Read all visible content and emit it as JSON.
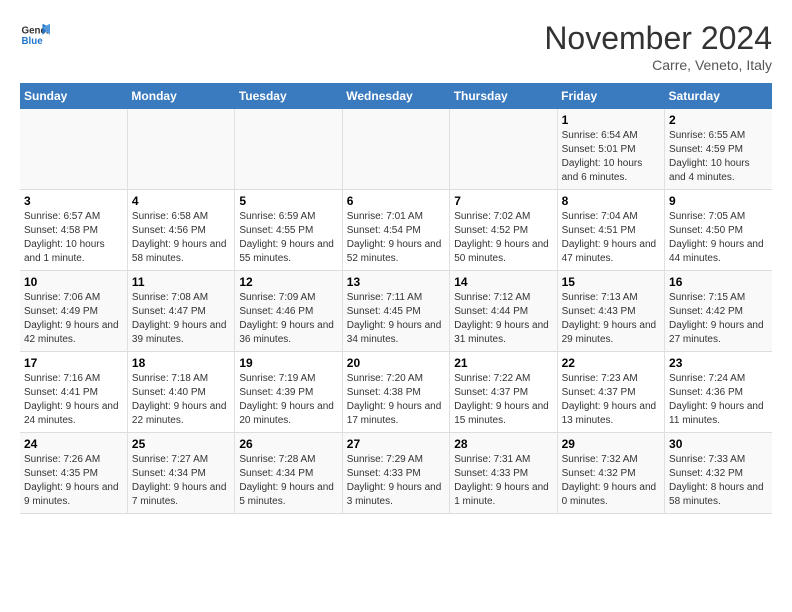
{
  "logo": {
    "general": "General",
    "blue": "Blue"
  },
  "title": "November 2024",
  "subtitle": "Carre, Veneto, Italy",
  "days_header": [
    "Sunday",
    "Monday",
    "Tuesday",
    "Wednesday",
    "Thursday",
    "Friday",
    "Saturday"
  ],
  "weeks": [
    [
      {
        "day": "",
        "info": ""
      },
      {
        "day": "",
        "info": ""
      },
      {
        "day": "",
        "info": ""
      },
      {
        "day": "",
        "info": ""
      },
      {
        "day": "",
        "info": ""
      },
      {
        "day": "1",
        "info": "Sunrise: 6:54 AM\nSunset: 5:01 PM\nDaylight: 10 hours and 6 minutes."
      },
      {
        "day": "2",
        "info": "Sunrise: 6:55 AM\nSunset: 4:59 PM\nDaylight: 10 hours and 4 minutes."
      }
    ],
    [
      {
        "day": "3",
        "info": "Sunrise: 6:57 AM\nSunset: 4:58 PM\nDaylight: 10 hours and 1 minute."
      },
      {
        "day": "4",
        "info": "Sunrise: 6:58 AM\nSunset: 4:56 PM\nDaylight: 9 hours and 58 minutes."
      },
      {
        "day": "5",
        "info": "Sunrise: 6:59 AM\nSunset: 4:55 PM\nDaylight: 9 hours and 55 minutes."
      },
      {
        "day": "6",
        "info": "Sunrise: 7:01 AM\nSunset: 4:54 PM\nDaylight: 9 hours and 52 minutes."
      },
      {
        "day": "7",
        "info": "Sunrise: 7:02 AM\nSunset: 4:52 PM\nDaylight: 9 hours and 50 minutes."
      },
      {
        "day": "8",
        "info": "Sunrise: 7:04 AM\nSunset: 4:51 PM\nDaylight: 9 hours and 47 minutes."
      },
      {
        "day": "9",
        "info": "Sunrise: 7:05 AM\nSunset: 4:50 PM\nDaylight: 9 hours and 44 minutes."
      }
    ],
    [
      {
        "day": "10",
        "info": "Sunrise: 7:06 AM\nSunset: 4:49 PM\nDaylight: 9 hours and 42 minutes."
      },
      {
        "day": "11",
        "info": "Sunrise: 7:08 AM\nSunset: 4:47 PM\nDaylight: 9 hours and 39 minutes."
      },
      {
        "day": "12",
        "info": "Sunrise: 7:09 AM\nSunset: 4:46 PM\nDaylight: 9 hours and 36 minutes."
      },
      {
        "day": "13",
        "info": "Sunrise: 7:11 AM\nSunset: 4:45 PM\nDaylight: 9 hours and 34 minutes."
      },
      {
        "day": "14",
        "info": "Sunrise: 7:12 AM\nSunset: 4:44 PM\nDaylight: 9 hours and 31 minutes."
      },
      {
        "day": "15",
        "info": "Sunrise: 7:13 AM\nSunset: 4:43 PM\nDaylight: 9 hours and 29 minutes."
      },
      {
        "day": "16",
        "info": "Sunrise: 7:15 AM\nSunset: 4:42 PM\nDaylight: 9 hours and 27 minutes."
      }
    ],
    [
      {
        "day": "17",
        "info": "Sunrise: 7:16 AM\nSunset: 4:41 PM\nDaylight: 9 hours and 24 minutes."
      },
      {
        "day": "18",
        "info": "Sunrise: 7:18 AM\nSunset: 4:40 PM\nDaylight: 9 hours and 22 minutes."
      },
      {
        "day": "19",
        "info": "Sunrise: 7:19 AM\nSunset: 4:39 PM\nDaylight: 9 hours and 20 minutes."
      },
      {
        "day": "20",
        "info": "Sunrise: 7:20 AM\nSunset: 4:38 PM\nDaylight: 9 hours and 17 minutes."
      },
      {
        "day": "21",
        "info": "Sunrise: 7:22 AM\nSunset: 4:37 PM\nDaylight: 9 hours and 15 minutes."
      },
      {
        "day": "22",
        "info": "Sunrise: 7:23 AM\nSunset: 4:37 PM\nDaylight: 9 hours and 13 minutes."
      },
      {
        "day": "23",
        "info": "Sunrise: 7:24 AM\nSunset: 4:36 PM\nDaylight: 9 hours and 11 minutes."
      }
    ],
    [
      {
        "day": "24",
        "info": "Sunrise: 7:26 AM\nSunset: 4:35 PM\nDaylight: 9 hours and 9 minutes."
      },
      {
        "day": "25",
        "info": "Sunrise: 7:27 AM\nSunset: 4:34 PM\nDaylight: 9 hours and 7 minutes."
      },
      {
        "day": "26",
        "info": "Sunrise: 7:28 AM\nSunset: 4:34 PM\nDaylight: 9 hours and 5 minutes."
      },
      {
        "day": "27",
        "info": "Sunrise: 7:29 AM\nSunset: 4:33 PM\nDaylight: 9 hours and 3 minutes."
      },
      {
        "day": "28",
        "info": "Sunrise: 7:31 AM\nSunset: 4:33 PM\nDaylight: 9 hours and 1 minute."
      },
      {
        "day": "29",
        "info": "Sunrise: 7:32 AM\nSunset: 4:32 PM\nDaylight: 9 hours and 0 minutes."
      },
      {
        "day": "30",
        "info": "Sunrise: 7:33 AM\nSunset: 4:32 PM\nDaylight: 8 hours and 58 minutes."
      }
    ]
  ]
}
